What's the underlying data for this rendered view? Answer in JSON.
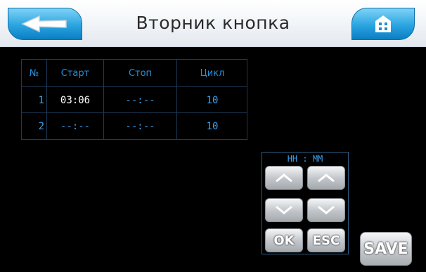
{
  "header": {
    "title": "Вторник кнопка",
    "back_icon": "arrow-left-icon",
    "home_icon": "home-icon",
    "accent_color": "#2aa4e0"
  },
  "table": {
    "columns": [
      "№",
      "Старт",
      "Стоп",
      "Цикл"
    ],
    "rows": [
      {
        "num": "1",
        "start": "03:06",
        "stop": "--:--",
        "cycle": "10"
      },
      {
        "num": "2",
        "start": "--:--",
        "stop": "--:--",
        "cycle": "10"
      }
    ]
  },
  "keypad": {
    "label": "HH : MM",
    "up_icon": "chevron-up-icon",
    "down_icon": "chevron-down-icon",
    "ok_label": "OK",
    "esc_label": "ESC"
  },
  "save_label": "SAVE",
  "colors": {
    "text_blue": "#3aa1ef",
    "grid": "#1d3a57",
    "background": "#000000"
  }
}
